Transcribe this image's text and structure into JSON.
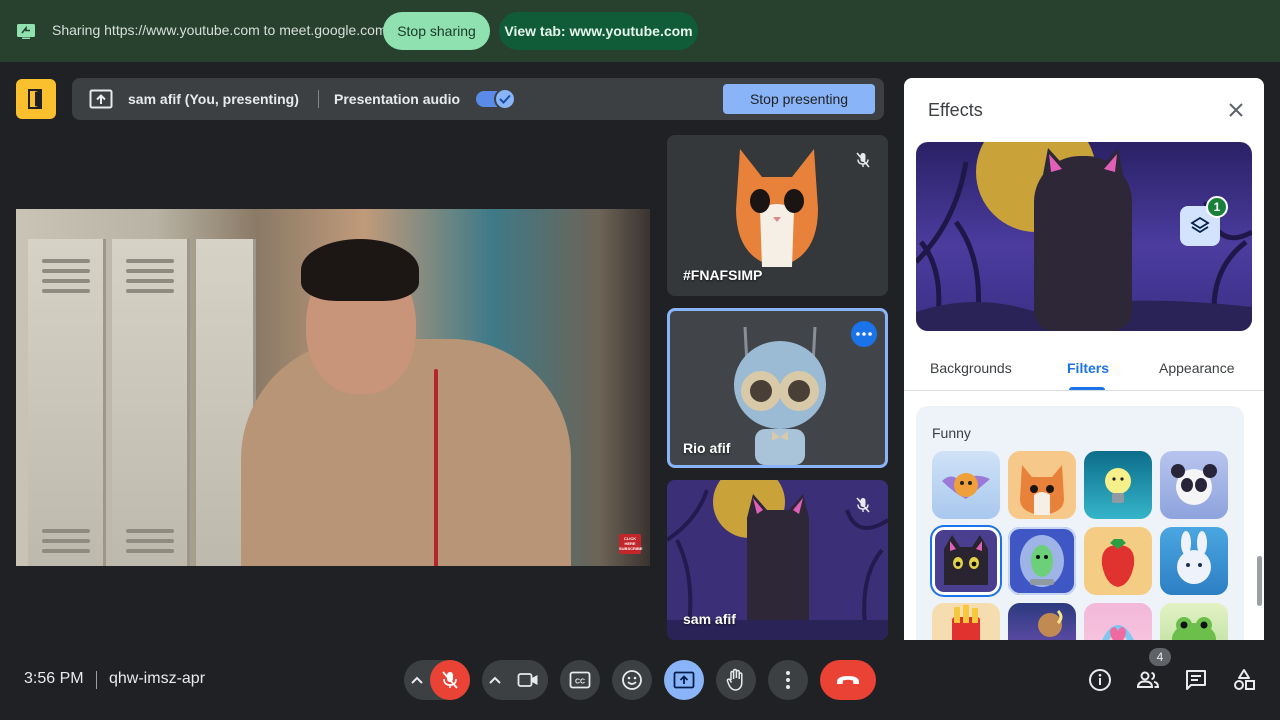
{
  "share_bar": {
    "message": "Sharing https://www.youtube.com to meet.google.com",
    "stop_sharing_label": "Stop sharing",
    "view_tab_label": "View tab: www.youtube.com"
  },
  "presenting_bar": {
    "presenter": "sam afif (You, presenting)",
    "audio_label": "Presentation audio",
    "audio_enabled": true,
    "stop_presenting_label": "Stop presenting"
  },
  "participants": [
    {
      "name": "#FNAFSIMP",
      "muted": true
    },
    {
      "name": "Rio afif",
      "muted": false,
      "active": true
    },
    {
      "name": "sam afif",
      "muted": true
    }
  ],
  "main_video": {
    "badge_text": "CLICK HERE SUBSCRIBE"
  },
  "effects_panel": {
    "title": "Effects",
    "applied_count": "1",
    "tabs": [
      {
        "label": "Backgrounds",
        "selected": false
      },
      {
        "label": "Filters",
        "selected": true
      },
      {
        "label": "Appearance",
        "selected": false
      }
    ],
    "section_label": "Funny"
  },
  "bottom_bar": {
    "time": "3:56 PM",
    "meeting_code": "qhw-imsz-apr",
    "people_count": "4"
  },
  "colors": {
    "share_bar_bg": "#28412f",
    "stop_sharing_bg": "#8fe1b0",
    "view_tab_bg": "#105c39",
    "meet_bg": "#202124",
    "accent_blue": "#8ab4f8",
    "end_call_red": "#ea4335",
    "filters_tab_blue": "#1a73e8"
  },
  "icons": [
    "screen-share-icon",
    "meet-logo-icon",
    "present-upload-icon",
    "check-icon",
    "mic-off-icon",
    "more-options-icon",
    "close-icon",
    "layers-icon",
    "chevron-up-icon",
    "camera-icon",
    "captions-icon",
    "emoji-icon",
    "present-screen-icon",
    "raise-hand-icon",
    "more-vert-icon",
    "end-call-icon",
    "info-icon",
    "people-icon",
    "chat-icon",
    "activities-icon"
  ]
}
